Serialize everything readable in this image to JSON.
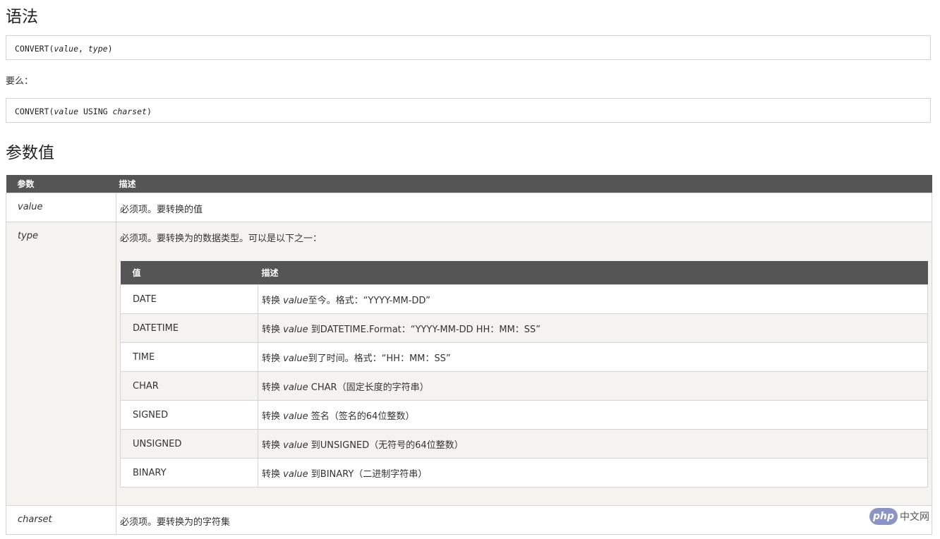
{
  "headings": {
    "syntax": "语法",
    "params": "参数值"
  },
  "syntax": {
    "line1": {
      "fn": "CONVERT(",
      "arg1": "value",
      "sep": ", ",
      "arg2": "type",
      "end": ")"
    },
    "or": "要么：",
    "line2": {
      "fn": "CONVERT(",
      "arg1": "value",
      "sep": " USING ",
      "arg2": "charset",
      "end": ")"
    }
  },
  "params_table": {
    "headers": [
      "参数",
      "描述"
    ],
    "rows": [
      {
        "name": "value",
        "desc": "必须项。要转换的值"
      },
      {
        "name": "type",
        "desc": "必须项。要转换为的数据类型。可以是以下之一："
      },
      {
        "name": "charset",
        "desc": "必须项。要转换为的字符集"
      }
    ]
  },
  "types_table": {
    "headers": [
      "值",
      "描述"
    ],
    "rows": [
      {
        "value": "DATE",
        "pre": "转换 ",
        "em": "value",
        "post": "至今。格式：“YYYY-MM-DD”"
      },
      {
        "value": "DATETIME",
        "pre": "转换 ",
        "em": "value",
        "post": " 到DATETIME.Format：“YYYY-MM-DD HH：MM：SS”"
      },
      {
        "value": "TIME",
        "pre": "转换 ",
        "em": "value",
        "post": "到了时间。格式：“HH：MM：SS”"
      },
      {
        "value": "CHAR",
        "pre": "转换 ",
        "em": "value",
        "post": " CHAR（固定长度的字符串）"
      },
      {
        "value": "SIGNED",
        "pre": "转换 ",
        "em": "value",
        "post": " 签名（签名的64位整数）"
      },
      {
        "value": "UNSIGNED",
        "pre": "转换 ",
        "em": "value",
        "post": " 到UNSIGNED（无符号的64位整数）"
      },
      {
        "value": "BINARY",
        "pre": "转换 ",
        "em": "value",
        "post": " 到BINARY（二进制字符串）"
      }
    ]
  },
  "watermark": {
    "logo": "php",
    "text": "中文网"
  }
}
